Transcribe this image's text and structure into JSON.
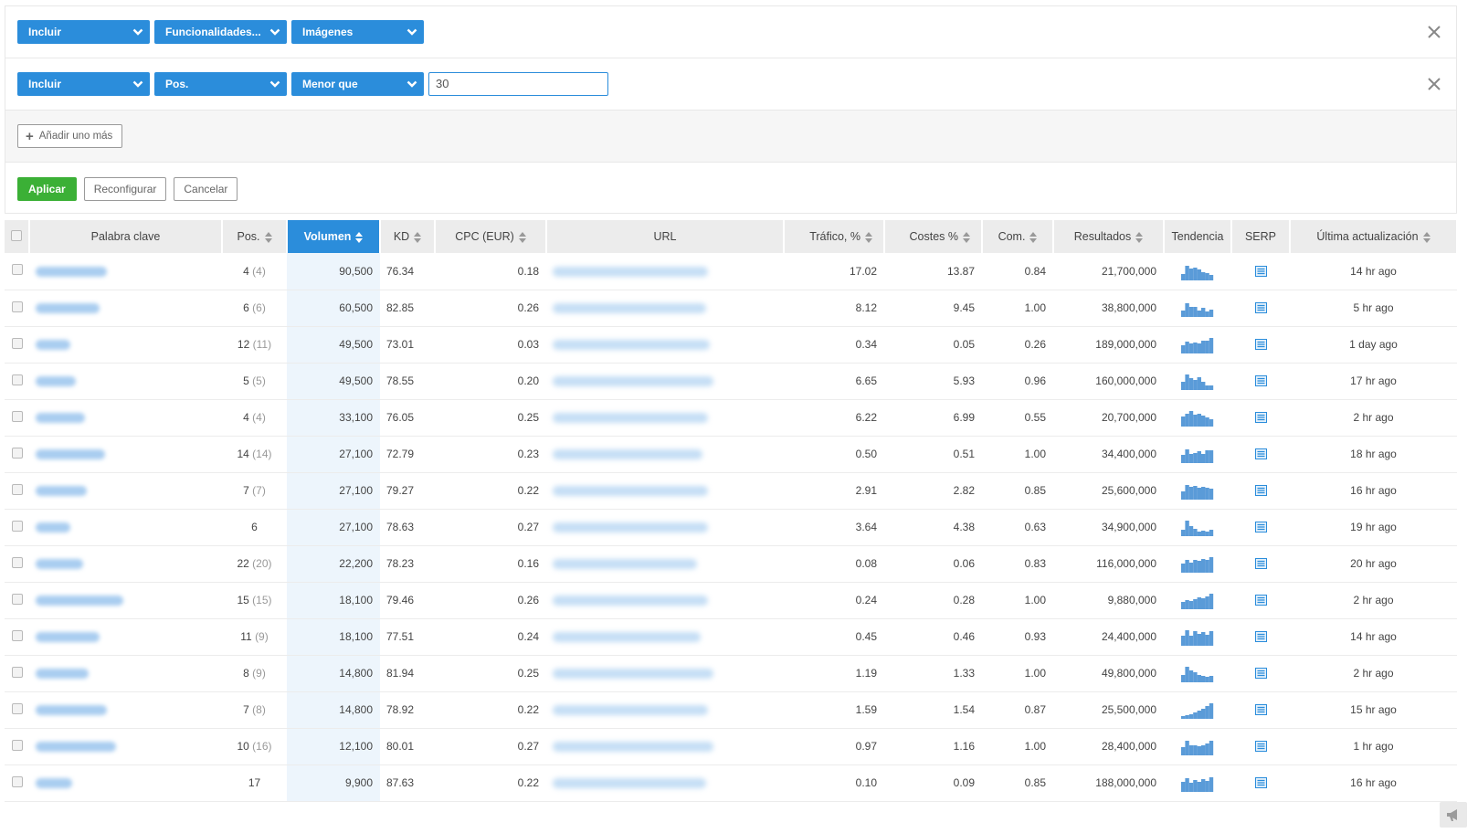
{
  "filters": {
    "row1": {
      "mode": "Incluir",
      "field": "Funcionalidades...",
      "value": "Imágenes"
    },
    "row2": {
      "mode": "Incluir",
      "field": "Pos.",
      "operator": "Menor que",
      "value": "30"
    },
    "add_more_label": "Añadir uno más",
    "apply_label": "Aplicar",
    "reset_label": "Reconfigurar",
    "cancel_label": "Cancelar"
  },
  "table": {
    "headers": {
      "keyword": "Palabra clave",
      "pos": "Pos.",
      "volume": "Volumen",
      "kd": "KD",
      "cpc": "CPC (EUR)",
      "url": "URL",
      "traffic": "Tráfico, %",
      "costs": "Costes %",
      "com": "Com.",
      "results": "Resultados",
      "trend": "Tendencia",
      "serp": "SERP",
      "updated": "Última actualización"
    },
    "sorted_column": "volume",
    "accent_color": "#2b8ddb",
    "rows": [
      {
        "pos": "4",
        "prev": "(4)",
        "volume": "90,500",
        "kd": "76.34",
        "cpc": "0.18",
        "traffic": "17.02",
        "costs": "13.87",
        "com": "0.84",
        "results": "21,700,000",
        "updated": "14 hr ago",
        "trend": [
          0.4,
          0.9,
          0.7,
          0.8,
          0.65,
          0.5,
          0.45,
          0.35
        ]
      },
      {
        "pos": "6",
        "prev": "(6)",
        "volume": "60,500",
        "kd": "82.85",
        "cpc": "0.26",
        "traffic": "8.12",
        "costs": "9.45",
        "com": "1.00",
        "results": "38,800,000",
        "updated": "5 hr ago",
        "trend": [
          0.4,
          0.85,
          0.6,
          0.6,
          0.4,
          0.55,
          0.35,
          0.45
        ]
      },
      {
        "pos": "12",
        "prev": "(11)",
        "volume": "49,500",
        "kd": "73.01",
        "cpc": "0.03",
        "traffic": "0.34",
        "costs": "0.05",
        "com": "0.26",
        "results": "189,000,000",
        "updated": "1 day ago",
        "trend": [
          0.5,
          0.7,
          0.6,
          0.65,
          0.6,
          0.75,
          0.8,
          0.95
        ]
      },
      {
        "pos": "5",
        "prev": "(5)",
        "volume": "49,500",
        "kd": "78.55",
        "cpc": "0.20",
        "traffic": "6.65",
        "costs": "5.93",
        "com": "0.96",
        "results": "160,000,000",
        "updated": "17 hr ago",
        "trend": [
          0.5,
          0.95,
          0.7,
          0.6,
          0.8,
          0.5,
          0.3,
          0.25
        ]
      },
      {
        "pos": "4",
        "prev": "(4)",
        "volume": "33,100",
        "kd": "76.05",
        "cpc": "0.25",
        "traffic": "6.22",
        "costs": "6.99",
        "com": "0.55",
        "results": "20,700,000",
        "updated": "2 hr ago",
        "trend": [
          0.6,
          0.8,
          0.95,
          0.7,
          0.8,
          0.65,
          0.55,
          0.45
        ]
      },
      {
        "pos": "14",
        "prev": "(14)",
        "volume": "27,100",
        "kd": "72.79",
        "cpc": "0.23",
        "traffic": "0.50",
        "costs": "0.51",
        "com": "1.00",
        "results": "34,400,000",
        "updated": "18 hr ago",
        "trend": [
          0.5,
          0.85,
          0.55,
          0.6,
          0.7,
          0.55,
          0.75,
          0.8
        ]
      },
      {
        "pos": "7",
        "prev": "(7)",
        "volume": "27,100",
        "kd": "79.27",
        "cpc": "0.22",
        "traffic": "2.91",
        "costs": "2.82",
        "com": "0.85",
        "results": "25,600,000",
        "updated": "16 hr ago",
        "trend": [
          0.5,
          0.9,
          0.8,
          0.85,
          0.7,
          0.75,
          0.7,
          0.65
        ]
      },
      {
        "pos": "6",
        "prev": "",
        "volume": "27,100",
        "kd": "78.63",
        "cpc": "0.27",
        "traffic": "3.64",
        "costs": "4.38",
        "com": "0.63",
        "results": "34,900,000",
        "updated": "19 hr ago",
        "trend": [
          0.4,
          0.95,
          0.6,
          0.45,
          0.3,
          0.35,
          0.3,
          0.4
        ]
      },
      {
        "pos": "22",
        "prev": "(20)",
        "volume": "22,200",
        "kd": "78.23",
        "cpc": "0.16",
        "traffic": "0.08",
        "costs": "0.06",
        "com": "0.83",
        "results": "116,000,000",
        "updated": "20 hr ago",
        "trend": [
          0.55,
          0.8,
          0.6,
          0.75,
          0.7,
          0.85,
          0.75,
          0.95
        ]
      },
      {
        "pos": "15",
        "prev": "(15)",
        "volume": "18,100",
        "kd": "79.46",
        "cpc": "0.26",
        "traffic": "0.24",
        "costs": "0.28",
        "com": "1.00",
        "results": "9,880,000",
        "updated": "2 hr ago",
        "trend": [
          0.45,
          0.55,
          0.5,
          0.6,
          0.7,
          0.65,
          0.8,
          0.95
        ]
      },
      {
        "pos": "11",
        "prev": "(9)",
        "volume": "18,100",
        "kd": "77.51",
        "cpc": "0.24",
        "traffic": "0.45",
        "costs": "0.46",
        "com": "0.93",
        "results": "24,400,000",
        "updated": "14 hr ago",
        "trend": [
          0.6,
          0.95,
          0.6,
          0.9,
          0.7,
          0.85,
          0.65,
          0.9
        ]
      },
      {
        "pos": "8",
        "prev": "(9)",
        "volume": "14,800",
        "kd": "81.94",
        "cpc": "0.25",
        "traffic": "1.19",
        "costs": "1.33",
        "com": "1.00",
        "results": "49,800,000",
        "updated": "2 hr ago",
        "trend": [
          0.45,
          0.95,
          0.7,
          0.6,
          0.45,
          0.4,
          0.35,
          0.4
        ]
      },
      {
        "pos": "7",
        "prev": "(8)",
        "volume": "14,800",
        "kd": "78.92",
        "cpc": "0.22",
        "traffic": "1.59",
        "costs": "1.54",
        "com": "0.87",
        "results": "25,500,000",
        "updated": "15 hr ago",
        "trend": [
          0.15,
          0.2,
          0.3,
          0.4,
          0.5,
          0.6,
          0.75,
          0.95
        ]
      },
      {
        "pos": "10",
        "prev": "(16)",
        "volume": "12,100",
        "kd": "80.01",
        "cpc": "0.27",
        "traffic": "0.97",
        "costs": "1.16",
        "com": "1.00",
        "results": "28,400,000",
        "updated": "1 hr ago",
        "trend": [
          0.5,
          0.9,
          0.6,
          0.6,
          0.55,
          0.6,
          0.7,
          0.9
        ]
      },
      {
        "pos": "17",
        "prev": "",
        "volume": "9,900",
        "kd": "87.63",
        "cpc": "0.22",
        "traffic": "0.10",
        "costs": "0.09",
        "com": "0.85",
        "results": "188,000,000",
        "updated": "16 hr ago",
        "trend": [
          0.6,
          0.85,
          0.55,
          0.7,
          0.6,
          0.75,
          0.65,
          0.9
        ]
      }
    ]
  },
  "icons": {
    "dropdown": "chevron-down-icon",
    "close": "close-icon",
    "serp": "serp-list-icon",
    "sort": "sort-arrows-icon",
    "corner": "megaphone-icon"
  },
  "colors": {
    "blue": "#2b8ddb",
    "green": "#3bb036",
    "header_bg": "#ececec",
    "volume_column_bg": "#edf5fc"
  }
}
